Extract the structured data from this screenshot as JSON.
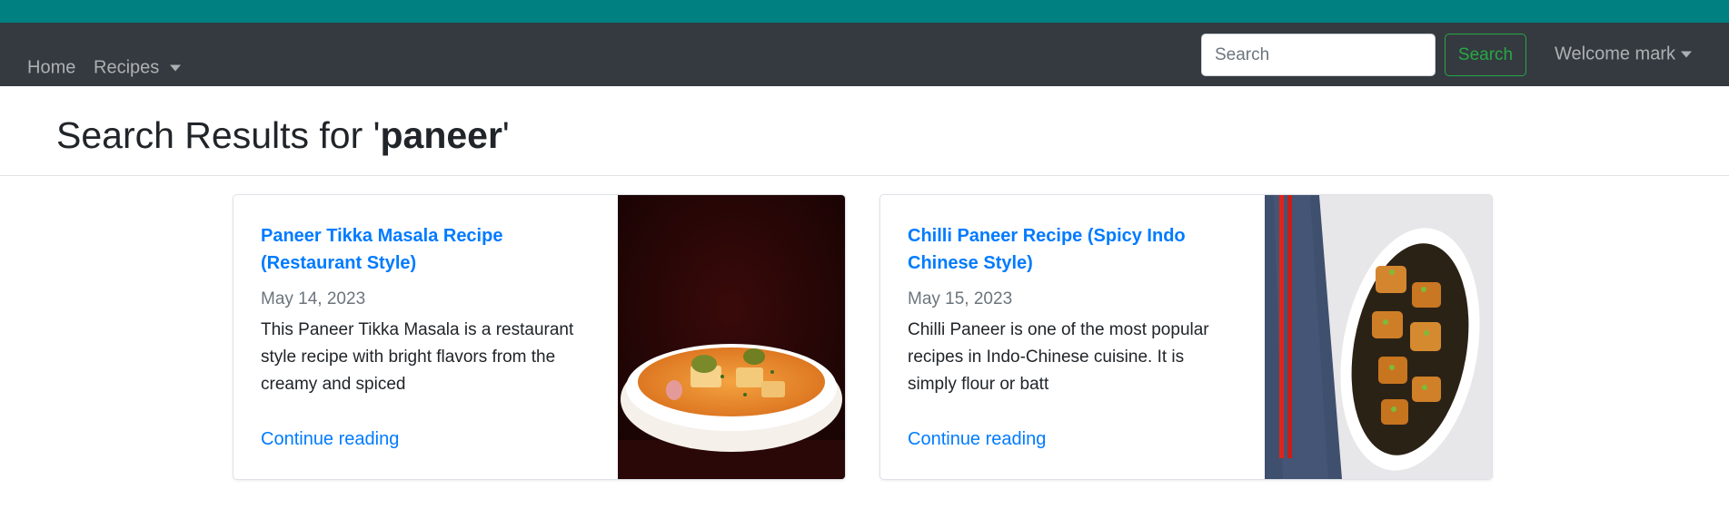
{
  "navbar": {
    "home_label": "Home",
    "recipes_label": "Recipes",
    "search_placeholder": "Search",
    "search_button": "Search",
    "welcome_label": "Welcome mark"
  },
  "page": {
    "title_prefix": "Search Results for '",
    "query": "paneer",
    "title_suffix": "'"
  },
  "results": [
    {
      "title_line1": "Paneer Tikka Masala Recipe",
      "title_line2": "(Restaurant Style)",
      "date": "May 14, 2023",
      "excerpt_line1": "This Paneer Tikka Masala is a restaurant",
      "excerpt_line2": "style recipe with bright flavors from the",
      "excerpt_line3": "creamy and spiced",
      "link": "Continue reading"
    },
    {
      "title_line1": "Chilli Paneer Recipe (Spicy Indo",
      "title_line2": "Chinese Style)",
      "date": "May 15, 2023",
      "excerpt_line1": "Chilli Paneer is one of the most popular",
      "excerpt_line2": "recipes in Indo-Chinese cuisine. It is",
      "excerpt_line3": "simply flour or batt",
      "link": "Continue reading"
    }
  ],
  "colors": {
    "topbar": "#008080",
    "navbar": "#343a40",
    "link": "#007bff",
    "success": "#28a745"
  }
}
